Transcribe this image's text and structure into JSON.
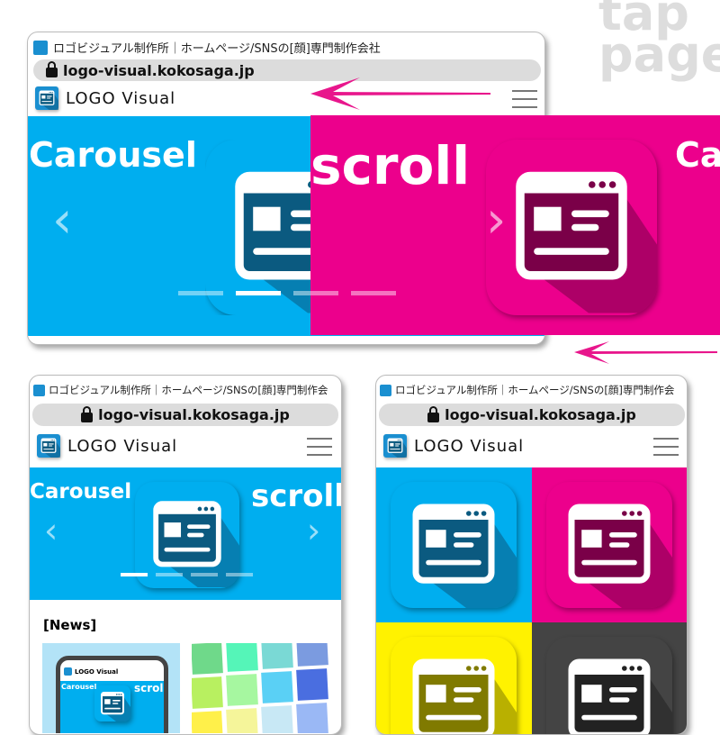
{
  "watermark": [
    "tap",
    "page"
  ],
  "browser": {
    "tab_title": "ロゴビジュアル制作所｜ホームページ/SNSの[顔]専門制作会社",
    "tab_title_short": "ロゴビジュアル制作所｜ホームページ/SNSの[顔]専門制作会",
    "url": "logo-visual.kokosaga.jp"
  },
  "site": {
    "logo_text": "LOGO Visual",
    "menu_icon": "hamburger-icon"
  },
  "carousel": {
    "slide1_label": "Carousel",
    "slide2_label": "scroll",
    "slide3_label_partial": "Ca",
    "dots": 4,
    "active_dot": 2,
    "colors": {
      "cyan": "#00aeef",
      "magenta": "#ec008c",
      "yellow": "#fff200",
      "black": "#444444"
    }
  },
  "news": {
    "heading": "[News]",
    "thumb1": {
      "logo_text": "LOGO Visual",
      "label1": "Carousel",
      "label2": "scroll"
    }
  },
  "arrow_color": "#e8168c"
}
